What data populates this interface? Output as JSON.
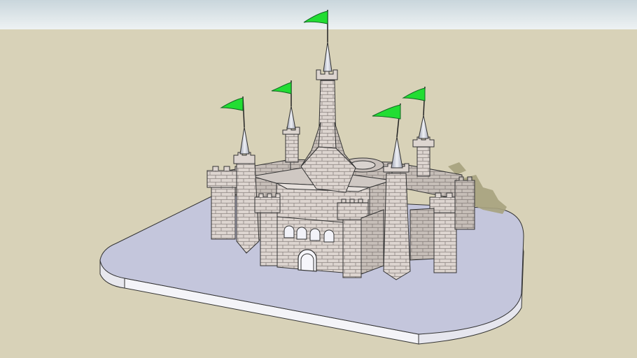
{
  "scene": {
    "kind": "3d-model-viewport",
    "subject": "castle",
    "flag_count": 5,
    "colors": {
      "sky_top": "#c9d6dc",
      "sky_bottom": "#eef2f3",
      "ground": "#d8d2b8",
      "base_top": "#c4c6dc",
      "base_side": "#f4f4f8",
      "stone": "#ddd5d0",
      "stone_dark": "#b9b1ac",
      "mortar": "#8c8480",
      "spire": "#c9ccd6",
      "flag": "#22dd33",
      "flag_dark": "#11a82a",
      "shadow": "#a7a27e"
    }
  }
}
